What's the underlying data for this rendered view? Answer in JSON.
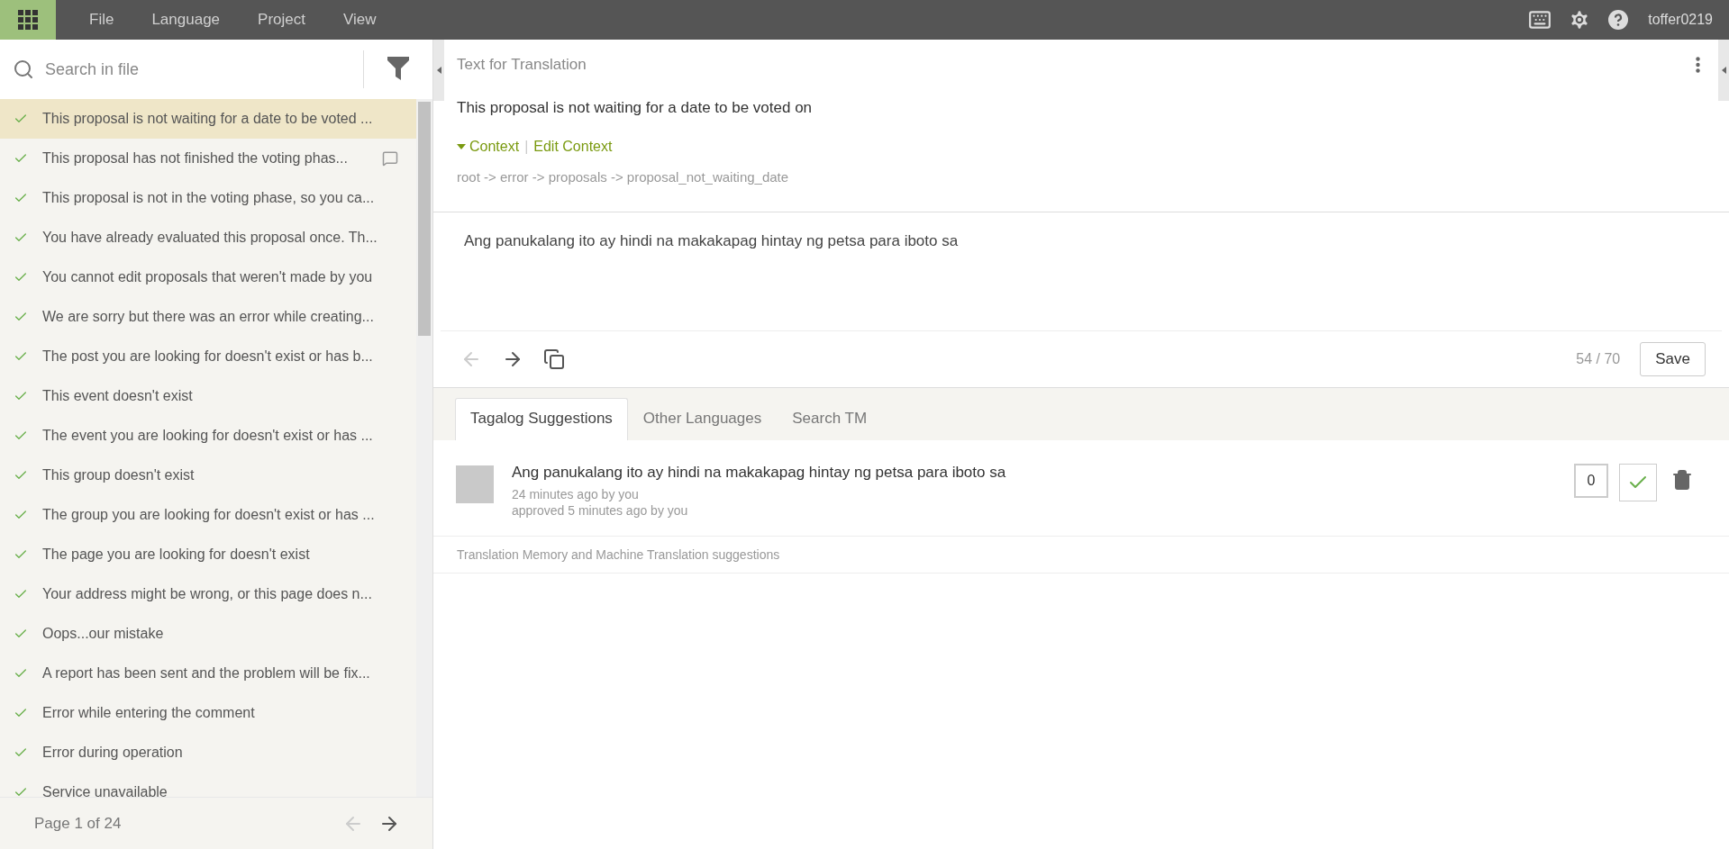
{
  "menu": {
    "items": [
      "File",
      "Language",
      "Project",
      "View"
    ],
    "username": "toffer0219"
  },
  "sidebar": {
    "search": {
      "placeholder": "Search in file"
    },
    "items": [
      {
        "text": "This proposal is not waiting for a date to be voted ...",
        "translated": true,
        "selected": true,
        "has_comment": false
      },
      {
        "text": "This proposal has not finished the voting phas...",
        "translated": true,
        "selected": false,
        "has_comment": true
      },
      {
        "text": "This proposal is not in the voting phase, so you ca...",
        "translated": true,
        "selected": false,
        "has_comment": false
      },
      {
        "text": "You have already evaluated this proposal once. Th...",
        "translated": true,
        "selected": false,
        "has_comment": false
      },
      {
        "text": "You cannot edit proposals that weren't made by you",
        "translated": true,
        "selected": false,
        "has_comment": false
      },
      {
        "text": "We are sorry but there was an error while creating...",
        "translated": true,
        "selected": false,
        "has_comment": false
      },
      {
        "text": "The post you are looking for doesn't exist or has b...",
        "translated": true,
        "selected": false,
        "has_comment": false
      },
      {
        "text": "This event doesn't exist",
        "translated": true,
        "selected": false,
        "has_comment": false
      },
      {
        "text": "The event you are looking for doesn't exist or has ...",
        "translated": true,
        "selected": false,
        "has_comment": false
      },
      {
        "text": "This group doesn't exist",
        "translated": true,
        "selected": false,
        "has_comment": false
      },
      {
        "text": "The group you are looking for doesn't exist or has ...",
        "translated": true,
        "selected": false,
        "has_comment": false
      },
      {
        "text": "The page you are looking for doesn't exist",
        "translated": true,
        "selected": false,
        "has_comment": false
      },
      {
        "text": "Your address might be wrong, or this page does n...",
        "translated": true,
        "selected": false,
        "has_comment": false
      },
      {
        "text": "Oops...our mistake",
        "translated": true,
        "selected": false,
        "has_comment": false
      },
      {
        "text": "A report has been sent and the problem will be fix...",
        "translated": true,
        "selected": false,
        "has_comment": false
      },
      {
        "text": "Error while entering the comment",
        "translated": true,
        "selected": false,
        "has_comment": false
      },
      {
        "text": "Error during operation",
        "translated": true,
        "selected": false,
        "has_comment": false
      },
      {
        "text": "Service unavailable",
        "translated": true,
        "selected": false,
        "has_comment": false
      }
    ],
    "pager": {
      "label": "Page 1 of 24",
      "prev_disabled": true
    }
  },
  "source": {
    "heading": "Text for Translation",
    "text": "This proposal is not waiting for a date to be voted on",
    "context_link": "Context",
    "separator": "|",
    "edit_context_link": "Edit Context",
    "context_expanded": true,
    "path": "root -> error -> proposals -> proposal_not_waiting_date"
  },
  "editor": {
    "translation": "Ang panukalang ito ay hindi na makakapag hintay ng petsa para iboto sa",
    "prev_disabled": true,
    "counter": "54 / 70",
    "save": "Save"
  },
  "tabs": [
    {
      "label": "Tagalog Suggestions",
      "selected": true
    },
    {
      "label": "Other Languages",
      "selected": false
    },
    {
      "label": "Search TM",
      "selected": false
    }
  ],
  "suggestions": [
    {
      "text": "Ang panukalang ito ay hindi na makakapag hintay ng petsa para iboto sa",
      "time": "24 minutes ago by you",
      "approval": "approved 5 minutes ago by you",
      "votes": "0",
      "approved": true
    }
  ],
  "tm_heading": "Translation Memory and Machine Translation suggestions"
}
